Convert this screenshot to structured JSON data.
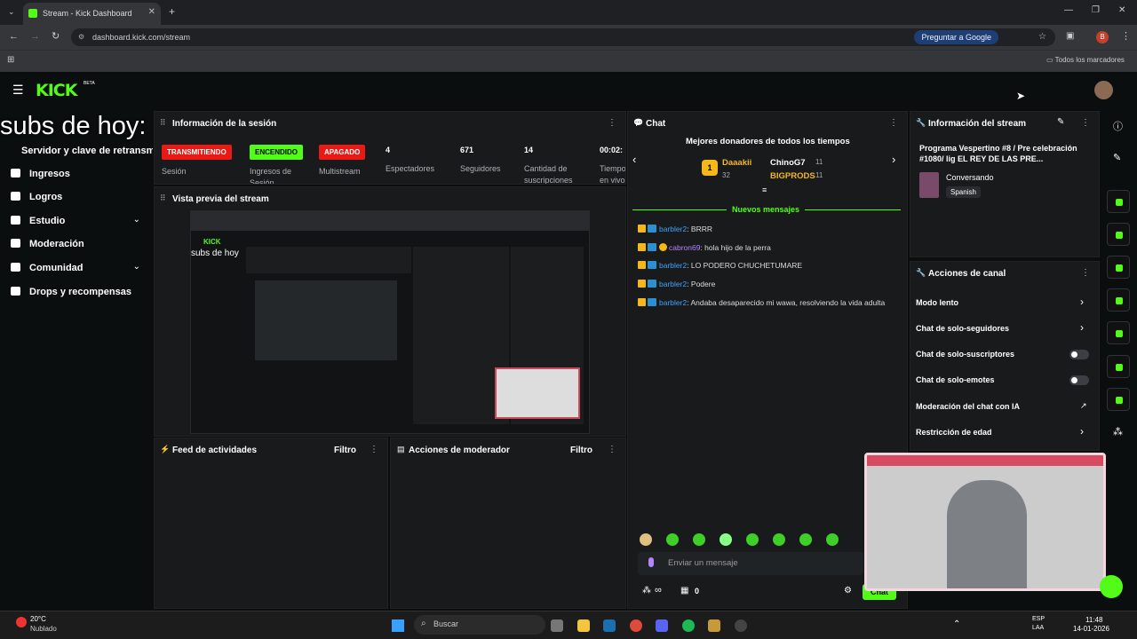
{
  "browser": {
    "tab_title": "Stream - Kick Dashboard",
    "url": "dashboard.kick.com/stream",
    "ask_google": "Preguntar a Google",
    "bookmarks": "Todos los marcadores",
    "profile_initial": "B"
  },
  "overlay_text": "subs de hoy:",
  "sidebar": {
    "title": "Servidor y clave de retransm",
    "items": [
      {
        "label": "Ingresos"
      },
      {
        "label": "Logros"
      },
      {
        "label": "Estudio"
      },
      {
        "label": "Moderación"
      },
      {
        "label": "Comunidad"
      },
      {
        "label": "Drops y recompensas"
      }
    ]
  },
  "session": {
    "title": "Información de la sesión",
    "badges": {
      "live": "TRANSMITIENDO",
      "on": "ENCENDIDO",
      "off": "APAGADO"
    },
    "labels": {
      "sesion": "Sesión",
      "ingresos": "Ingresos de Sesión",
      "multistream": "Multistream",
      "espectadores": "Espectadores",
      "seguidores": "Seguidores",
      "suscripciones": "Cantidad de suscripciones",
      "tiempo": "Tiempo en vivo"
    },
    "values": {
      "espectadores": "4",
      "seguidores": "671",
      "suscripciones": "14",
      "tiempo": "00:02:"
    }
  },
  "preview": {
    "title": "Vista previa del stream",
    "inner_text": "subs de hoy"
  },
  "activity": {
    "title": "Feed de actividades",
    "filter": "Filtro"
  },
  "modactions": {
    "title": "Acciones de moderador",
    "filter": "Filtro"
  },
  "chat": {
    "title": "Chat",
    "top_title": "Mejores donadores de todos los tiempos",
    "donors": [
      {
        "name": "Daaakii",
        "count": "32",
        "rank": "1"
      },
      {
        "name": "ChinoG7",
        "count": "11"
      },
      {
        "name": "BIGPRODS",
        "count": "11"
      }
    ],
    "new_messages": "Nuevos mensajes",
    "messages": [
      {
        "user": "barbler2",
        "text": ": BRRR"
      },
      {
        "user": "cabron69",
        "text": ": hola hijo de la perra"
      },
      {
        "user": "barbler2",
        "text": ": LO PODERO CHUCHETUMARE"
      },
      {
        "user": "barbler2",
        "text": ": Podere"
      },
      {
        "user": "barbler2",
        "text": ": Andaba desaparecido mi wawa, resolviendo la vida adulta"
      }
    ],
    "input_placeholder": "Enviar un mensaje",
    "points": "0",
    "send": "Chat"
  },
  "stream_info": {
    "title": "Información del stream",
    "stream_title": "Programa Vespertino #8 / Pre celebración #1080/ lig EL REY DE LAS PRE...",
    "category": "Conversando",
    "language": "Spanish"
  },
  "channel_actions": {
    "title": "Acciones de canal",
    "items": [
      {
        "label": "Modo lento"
      },
      {
        "label": "Chat de solo-seguidores"
      },
      {
        "label": "Chat de solo-suscriptores"
      },
      {
        "label": "Chat de solo-emotes"
      },
      {
        "label": "Moderación del chat con IA"
      },
      {
        "label": "Restricción de edad"
      }
    ]
  },
  "taskbar": {
    "weather_temp": "20°C",
    "weather_desc": "Nublado",
    "search": "Buscar",
    "lang": "ESP",
    "lang2": "LAA",
    "time": "11:48",
    "date": "14-01-2026"
  },
  "colors": {
    "accent": "#53fc18",
    "live": "#e91916",
    "panel": "#181a1b",
    "link": "#3fa4ff"
  }
}
